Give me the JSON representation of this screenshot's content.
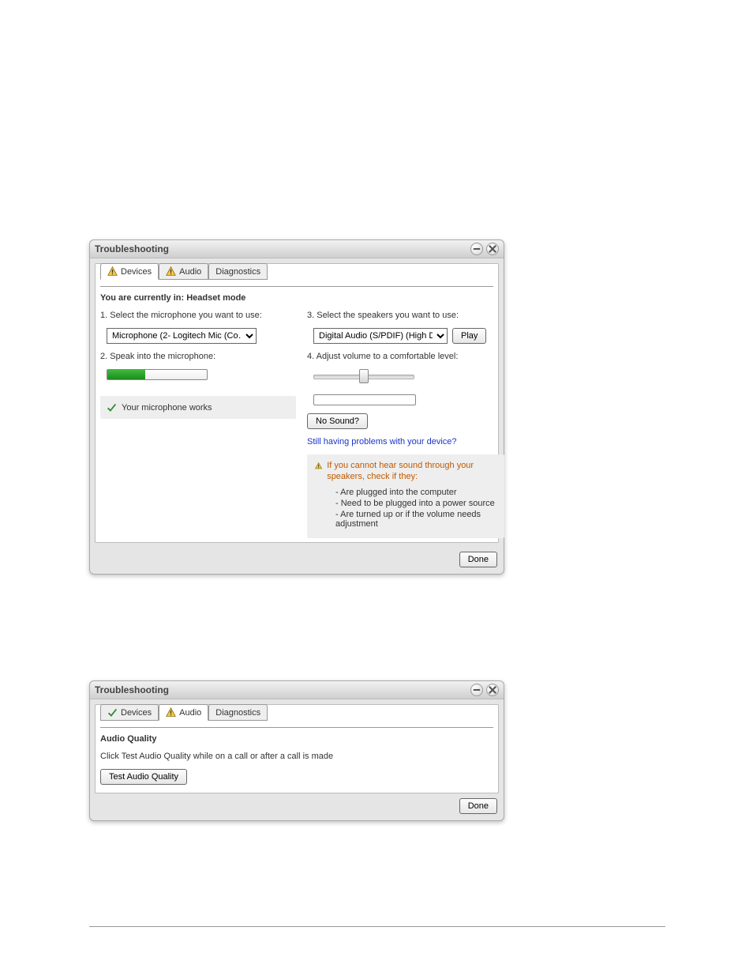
{
  "dialog1": {
    "title": "Troubleshooting",
    "tabs": {
      "devices": "Devices",
      "audio": "Audio",
      "diagnostics": "Diagnostics"
    },
    "heading": "You are currently in: Headset mode",
    "left": {
      "step1": "1. Select the microphone you want to use:",
      "micSelected": "Microphone (2- Logitech Mic (Co…",
      "step2": "2. Speak into the microphone:",
      "micStatus": "Your microphone works"
    },
    "right": {
      "step3": "3. Select the speakers you want to use:",
      "speakerSelected": "Digital Audio (S/PDIF) (High Defi…",
      "playLabel": "Play",
      "step4": "4. Adjust volume to a comfortable level:",
      "noSound": "No Sound?",
      "problemsLink": "Still having problems with your device?",
      "warnHead": "If you cannot hear sound through your speakers, check if they:",
      "check1": "- Are plugged into the computer",
      "check2": "- Need to be plugged into a power source",
      "check3": "- Are turned up or if the volume needs adjustment"
    },
    "doneLabel": "Done"
  },
  "dialog2": {
    "title": "Troubleshooting",
    "tabs": {
      "devices": "Devices",
      "audio": "Audio",
      "diagnostics": "Diagnostics"
    },
    "heading": "Audio Quality",
    "instruction": "Click Test Audio Quality while on a call or after a call is made",
    "testLabel": "Test Audio Quality",
    "doneLabel": "Done"
  }
}
